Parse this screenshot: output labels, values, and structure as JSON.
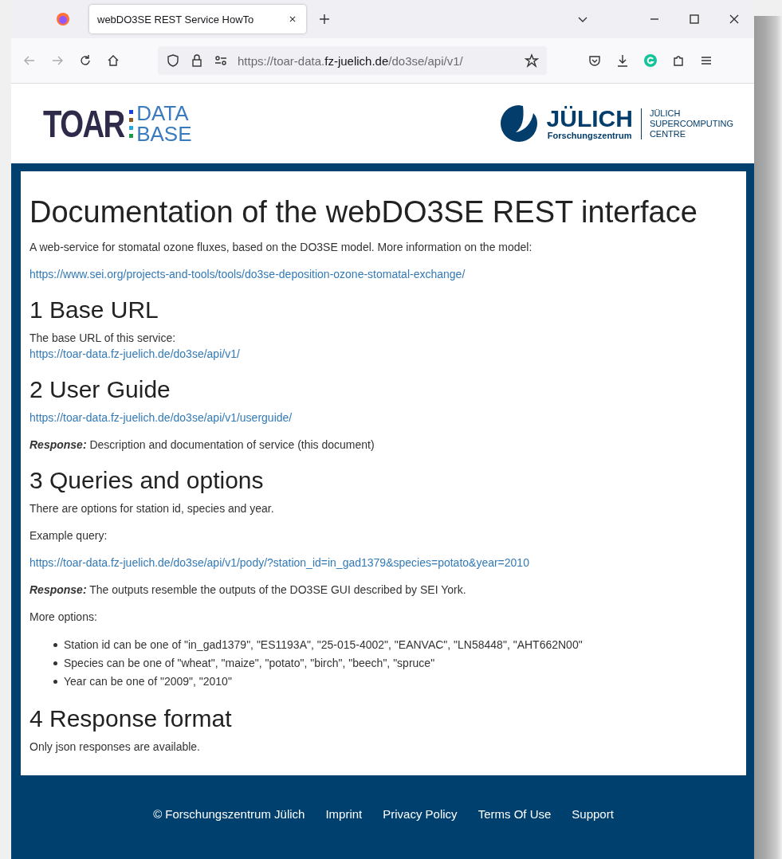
{
  "browser": {
    "tab": {
      "title": "webDO3SE REST Service HowTo",
      "selected": true
    },
    "address": {
      "prefix": "https://toar-data.",
      "domain": "fz-juelich.de",
      "path": "/do3se/api/v1/"
    }
  },
  "header": {
    "logo_left": {
      "word": "TOAR",
      "line1": "DATA",
      "line2": "BASE"
    },
    "logo_right": {
      "word": "JÜLICH",
      "sub": "Forschungszentrum",
      "lines": [
        "JÜLICH",
        "SUPERCOMPUTING",
        "CENTRE"
      ]
    }
  },
  "content": {
    "title": "Documentation of the webDO3SE REST interface",
    "blocks": [
      {
        "kind": "p",
        "text": "A web-service for stomatal ozone fluxes, based on the DO3SE model. More information on the model:"
      },
      {
        "kind": "link",
        "text": "https://www.sei.org/projects-and-tools/tools/do3se-deposition-ozone-stomatal-exchange/"
      },
      {
        "kind": "h",
        "text": "1 Base URL"
      },
      {
        "kind": "p2",
        "text": "The base URL of this service:",
        "link": "https://toar-data.fz-juelich.de/do3se/api/v1/"
      },
      {
        "kind": "h",
        "text": "2 User Guide"
      },
      {
        "kind": "link",
        "text": "https://toar-data.fz-juelich.de/do3se/api/v1/userguide/"
      },
      {
        "kind": "p",
        "text": "**Response:** Description and documentation of service (this document)"
      },
      {
        "kind": "h",
        "text": "3 Queries and options"
      },
      {
        "kind": "p",
        "text": "There are options for station id, species and year."
      },
      {
        "kind": "p",
        "text": "Example query:"
      },
      {
        "kind": "link",
        "text": "https://toar-data.fz-juelich.de/do3se/api/v1/pody/?station_id=in_gad1379&species=potato&year=2010"
      },
      {
        "kind": "p",
        "text": "**Response:** The outputs resemble the outputs of the DO3SE GUI described by SEI York."
      },
      {
        "kind": "p",
        "text": "More options:"
      },
      {
        "kind": "list",
        "items": [
          "Station id can be one of \"in_gad1379\", \"ES1193A\", \"25-015-4002\", \"EANVAC\", \"LN58448\", \"AHT662N00\"",
          "Species can be one of \"wheat\", \"maize\", \"potato\", \"birch\", \"beech\", \"spruce\"",
          "Year can be one of \"2009\", \"2010\""
        ]
      },
      {
        "kind": "h",
        "text": "4 Response format"
      },
      {
        "kind": "p",
        "text": "Only json responses are available."
      }
    ]
  },
  "footer": {
    "copyright": "© Forschungszentrum Jülich",
    "links": [
      "Imprint",
      "Privacy Policy",
      "Terms Of Use",
      "Support"
    ]
  }
}
